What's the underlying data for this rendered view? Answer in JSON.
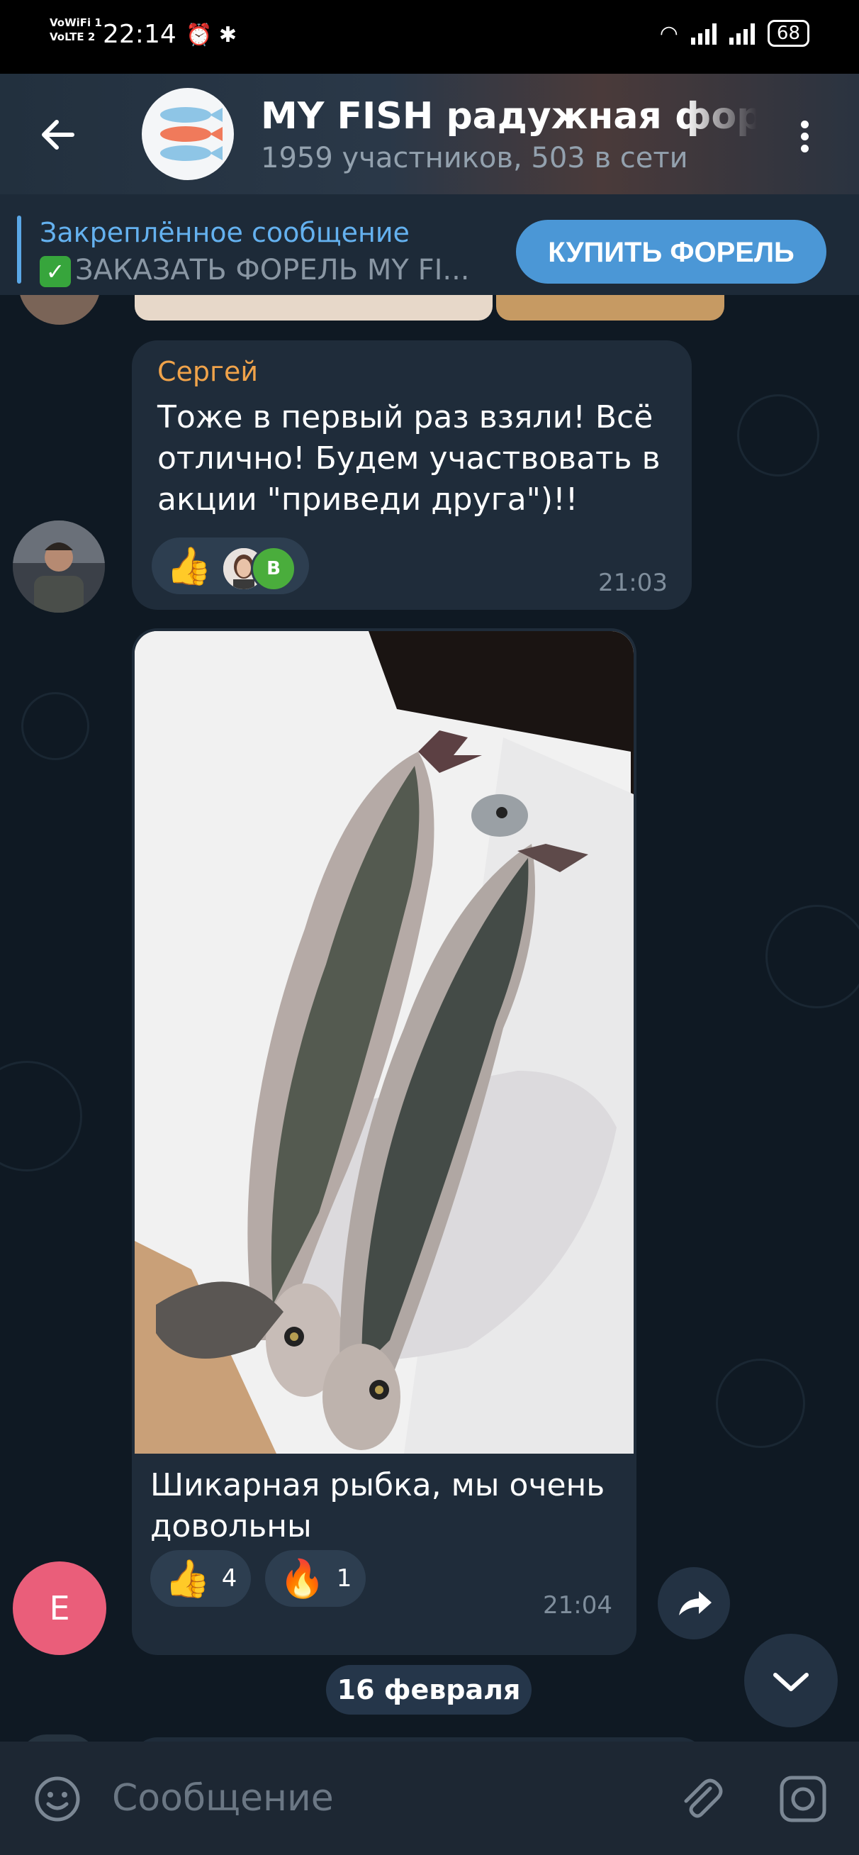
{
  "status_bar": {
    "sim_label_1": "VoWiFi 1",
    "sim_label_2": "VoLTE 2",
    "time": "22:14",
    "battery": "68"
  },
  "header": {
    "title": "MY FISH радужная форель",
    "subtitle": "1959 участников, 503 в сети"
  },
  "pinned": {
    "title": "Закреплённое сообщение",
    "text": "ЗАКАЗАТЬ ФОРЕЛЬ MY FI...",
    "button": "КУПИТЬ ФОРЕЛЬ"
  },
  "messages": [
    {
      "sender": "Сергей",
      "text": "Тоже в первый раз взяли! Всё отлично! Будем участвовать в акции \"приведи друга\")!!",
      "reaction_avatar_letter": "В",
      "time": "21:03"
    },
    {
      "text": "Шикарная рыбка, мы очень довольны",
      "reactions": [
        {
          "icon": "thumbs-up",
          "count": "4"
        },
        {
          "icon": "fire",
          "count": "1"
        }
      ],
      "time": "21:04",
      "avatar_letter": "E"
    }
  ],
  "date_separator": "16 февраля",
  "composer": {
    "placeholder": "Сообщение"
  },
  "colors": {
    "background": "#0f1923",
    "bubble": "#1f2c3a",
    "accent": "#4b97d6",
    "sender_name": "#f0a34a",
    "avatar_e": "#ea5e7a"
  }
}
